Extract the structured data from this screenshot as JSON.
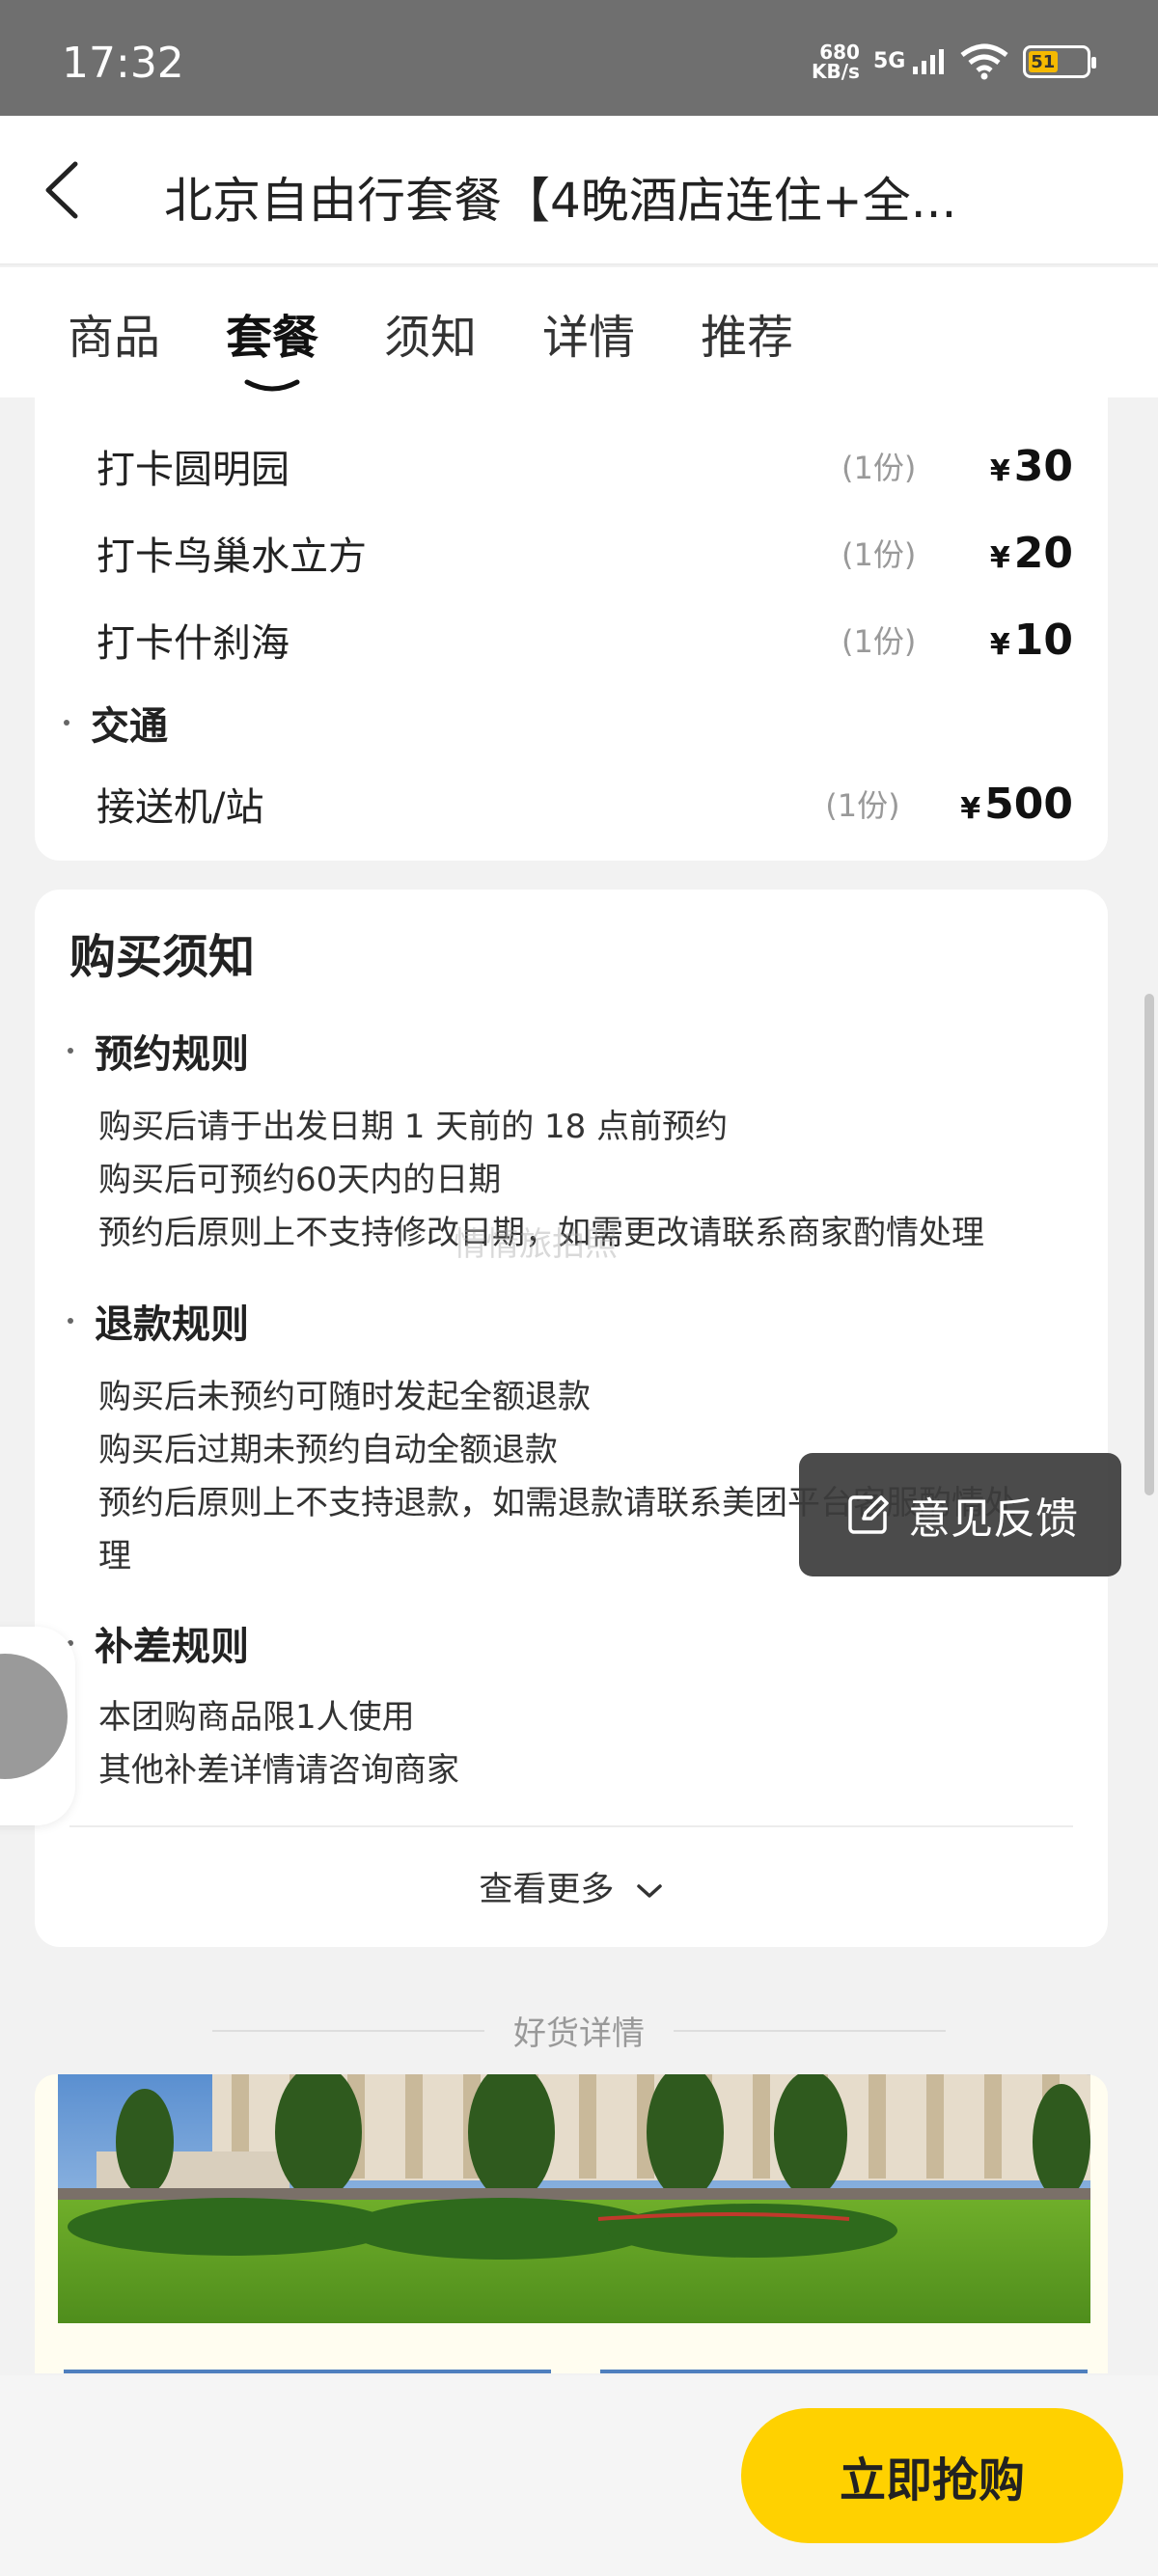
{
  "status_bar": {
    "time": "17:32",
    "net_speed_value": "680",
    "net_speed_unit": "KB/s",
    "network": "5G",
    "battery": "51"
  },
  "header": {
    "title": "北京自由行套餐【4晚酒店连住+全..."
  },
  "tabs": [
    {
      "label": "商品"
    },
    {
      "label": "套餐"
    },
    {
      "label": "须知"
    },
    {
      "label": "详情"
    },
    {
      "label": "推荐"
    }
  ],
  "active_tab": "套餐",
  "package_items": {
    "items": [
      {
        "name": "打卡圆明园",
        "qty": "(1份)",
        "currency": "¥",
        "price": "30"
      },
      {
        "name": "打卡鸟巢水立方",
        "qty": "(1份)",
        "currency": "¥",
        "price": "20"
      },
      {
        "name": "打卡什刹海",
        "qty": "(1份)",
        "currency": "¥",
        "price": "10"
      }
    ],
    "transport_category": "交通",
    "transport_item": {
      "name": "接送机/站",
      "qty": "(1份)",
      "currency": "¥",
      "price": "500"
    }
  },
  "purchase_notice": {
    "title": "购买须知",
    "booking_rules": {
      "heading": "预约规则",
      "lines": [
        "购买后请于出发日期 1 天前的 18 点前预约",
        "购买后可预约60天内的日期",
        "预约后原则上不支持修改日期，如需更改请联系商家酌情处理"
      ]
    },
    "refund_rules": {
      "heading": "退款规则",
      "lines": [
        "购买后未预约可随时发起全额退款",
        "购买后过期未预约自动全额退款",
        "预约后原则上不支持退款，如需退款请联系美团平台客服酌情处",
        "理"
      ]
    },
    "supplement_rules": {
      "heading": "补差规则",
      "lines": [
        "本团购商品限1人使用",
        "其他补差详情请咨询商家"
      ]
    },
    "see_more": "查看更多"
  },
  "watermark": "情情旅拍照",
  "details_section_label": "好货详情",
  "feedback_button": "意见反馈",
  "buy_button": "立即抢购",
  "colors": {
    "accent_yellow": "#ffd100",
    "battery_fill": "#f5b900",
    "status_bar": "#6f6f6f",
    "feedback_bg": "#3c3c3c"
  },
  "icons": [
    "back-arrow-icon",
    "chevron-down-icon",
    "feedback-edit-icon",
    "signal-icon",
    "wifi-icon",
    "battery-icon"
  ]
}
